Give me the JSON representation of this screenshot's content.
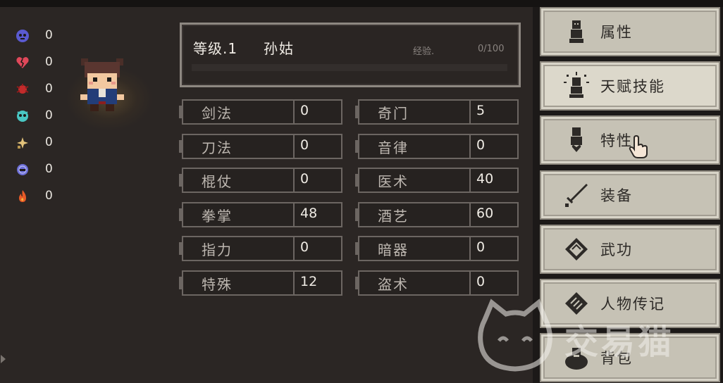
{
  "statuses": [
    {
      "icon": "skull-icon",
      "value": "0",
      "color": "#6a6ad6"
    },
    {
      "icon": "broken-heart-icon",
      "value": "0",
      "color": "#e0485a"
    },
    {
      "icon": "red-bug-icon",
      "value": "0",
      "color": "#c32b2b"
    },
    {
      "icon": "teal-skull-icon",
      "value": "0",
      "color": "#49c6c2"
    },
    {
      "icon": "star-sparkle-icon",
      "value": "0",
      "color": "#e2c27a"
    },
    {
      "icon": "helmet-icon",
      "value": "0",
      "color": "#6d6fd8"
    },
    {
      "icon": "flame-icon",
      "value": "0",
      "color": "#e85a27"
    }
  ],
  "level": {
    "level_text": "等级.1",
    "name": "孙姑",
    "exp_label": "经验.",
    "exp_value": "0/100",
    "exp_progress": 0
  },
  "stats": [
    {
      "label": "剑法",
      "value": "0"
    },
    {
      "label": "奇门",
      "value": "5"
    },
    {
      "label": "刀法",
      "value": "0"
    },
    {
      "label": "音律",
      "value": "0"
    },
    {
      "label": "棍仗",
      "value": "0"
    },
    {
      "label": "医术",
      "value": "40"
    },
    {
      "label": "拳掌",
      "value": "48"
    },
    {
      "label": "酒艺",
      "value": "60"
    },
    {
      "label": "指力",
      "value": "0"
    },
    {
      "label": "暗器",
      "value": "0"
    },
    {
      "label": "特殊",
      "value": "12"
    },
    {
      "label": "盗术",
      "value": "0"
    }
  ],
  "menu": [
    {
      "label": "属性",
      "icon": "character-icon",
      "active": false
    },
    {
      "label": "天赋技能",
      "icon": "glowing-character-icon",
      "active": true
    },
    {
      "label": "特性",
      "icon": "character-heart-icon",
      "active": false
    },
    {
      "label": "装备",
      "icon": "sword-icon",
      "active": false
    },
    {
      "label": "武功",
      "icon": "book-icon",
      "active": false
    },
    {
      "label": "人物传记",
      "icon": "scroll-icon",
      "active": false
    },
    {
      "label": "背包",
      "icon": "bag-icon",
      "active": false
    }
  ],
  "watermark": {
    "text": "交易猫"
  },
  "colors": {
    "background": "#2b2624",
    "menu_button": "#c6c2b5",
    "menu_text": "#2d2a27"
  }
}
